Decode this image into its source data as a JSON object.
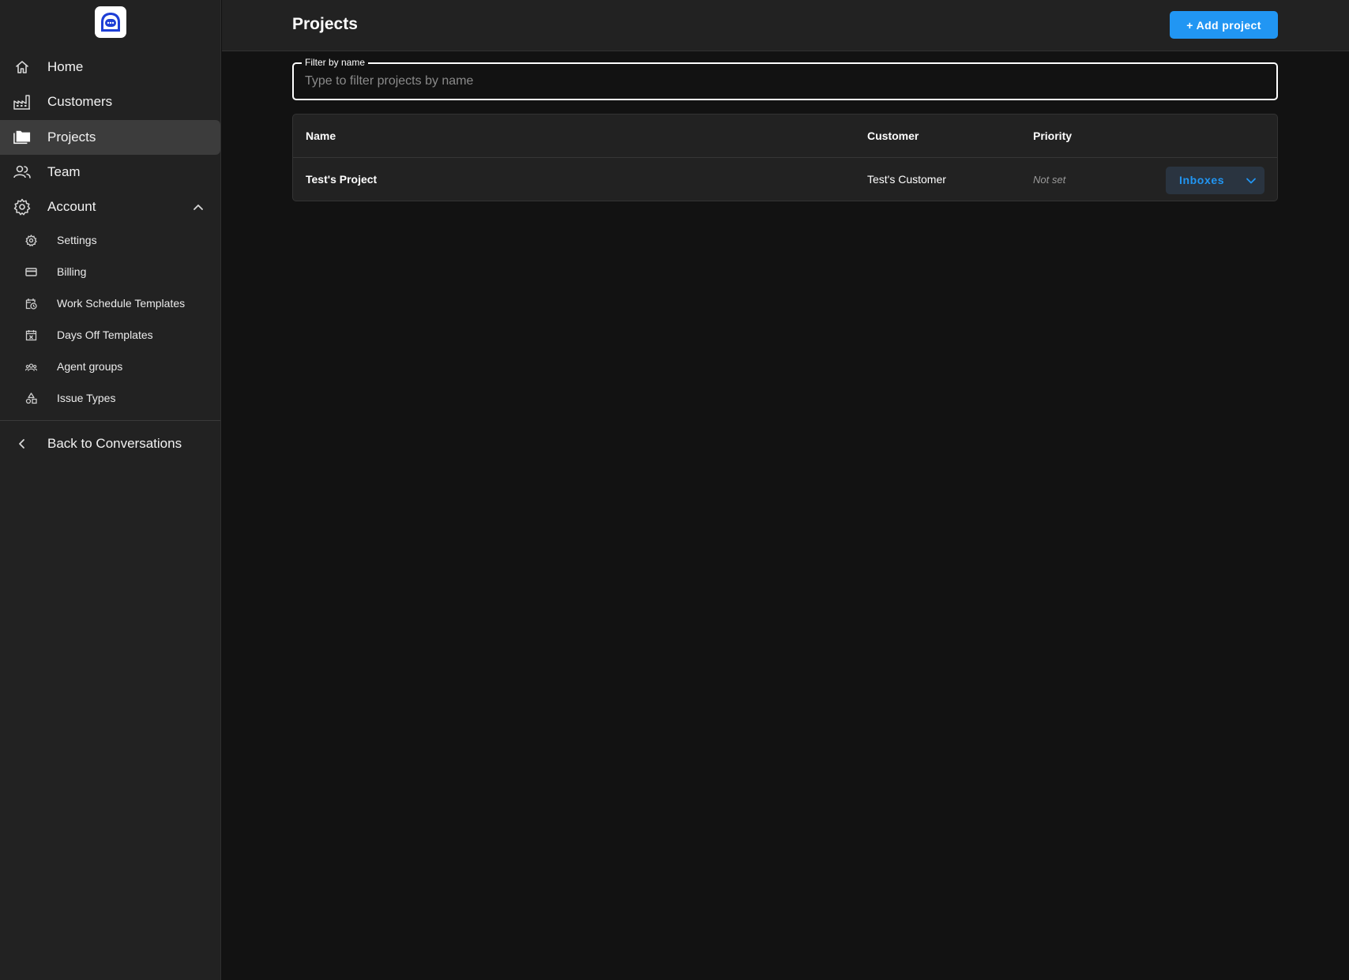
{
  "sidebar": {
    "logo": "chat-bubble-logo",
    "nav": [
      {
        "label": "Home",
        "icon": "home-icon"
      },
      {
        "label": "Customers",
        "icon": "factory-icon"
      },
      {
        "label": "Projects",
        "icon": "folders-icon",
        "active": true
      },
      {
        "label": "Team",
        "icon": "people-icon"
      },
      {
        "label": "Account",
        "icon": "gear-icon",
        "expanded": true
      }
    ],
    "account_items": [
      {
        "label": "Settings",
        "icon": "gear-icon"
      },
      {
        "label": "Billing",
        "icon": "credit-card-icon"
      },
      {
        "label": "Work Schedule Templates",
        "icon": "calendar-clock-icon"
      },
      {
        "label": "Days Off Templates",
        "icon": "calendar-x-icon"
      },
      {
        "label": "Agent groups",
        "icon": "group-icon"
      },
      {
        "label": "Issue Types",
        "icon": "shapes-icon"
      }
    ],
    "back": {
      "label": "Back to Conversations",
      "icon": "chevron-left-icon"
    }
  },
  "header": {
    "title": "Projects",
    "add_button": "+ Add project"
  },
  "filter": {
    "label": "Filter by name",
    "placeholder": "Type to filter projects by name",
    "value": ""
  },
  "table": {
    "columns": [
      "Name",
      "Customer",
      "Priority"
    ],
    "rows": [
      {
        "name": "Test's Project",
        "customer": "Test's Customer",
        "priority": "Not set",
        "action": "Inboxes"
      }
    ]
  },
  "colors": {
    "accent": "#2196f3",
    "background": "#121212",
    "surface": "#222222",
    "active_nav": "#3c3c3c"
  }
}
